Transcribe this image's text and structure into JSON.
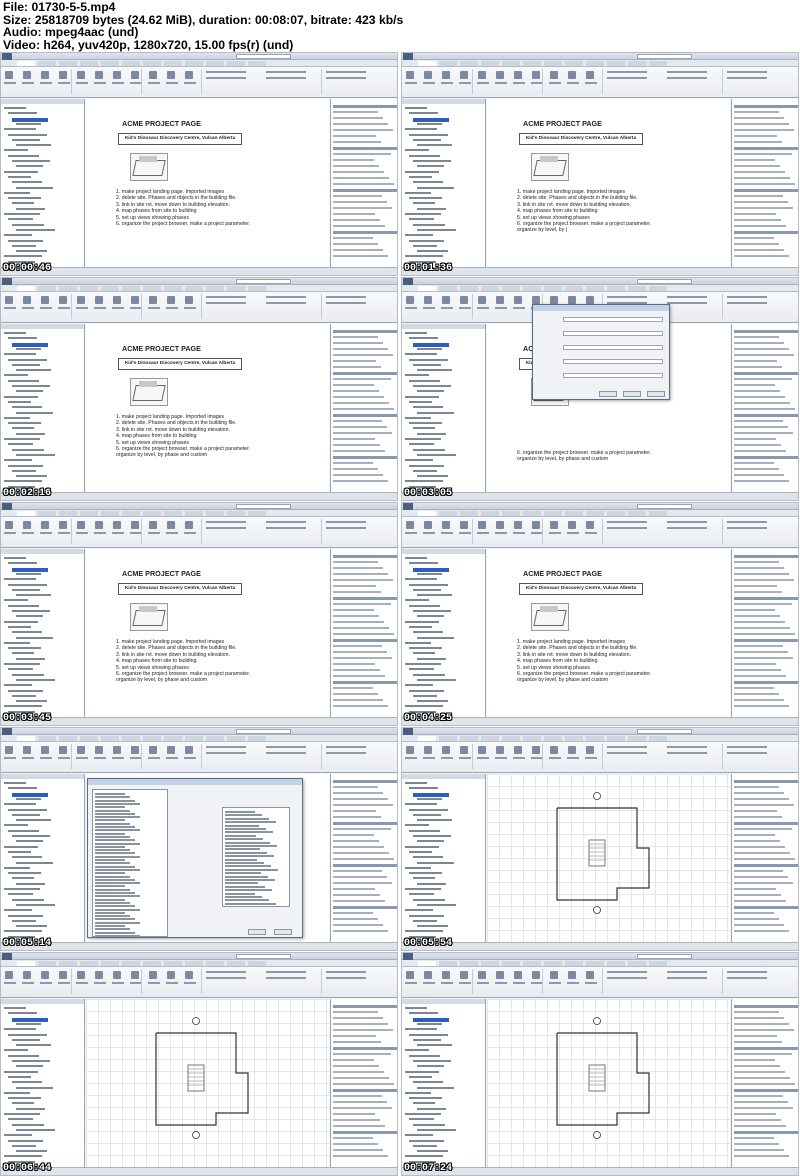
{
  "header": {
    "file": "File: 01730-5-5.mp4",
    "size": "Size: 25818709 bytes (24.62 MiB), duration: 00:08:07, bitrate: 423 kb/s",
    "audio": "Audio: mpeg4aac (und)",
    "video": "Video: h264, yuv420p, 1280x720, 15.00 fps(r) (und)"
  },
  "thumbnails": [
    {
      "timestamp": "00:00:46",
      "view": "page",
      "page_title": "ACME PROJECT PAGE",
      "project_name": "Kid's Dinosaur Discovery Centre, Vulcan Alberta",
      "notes": [
        "1. make project landing page. Imported images",
        "2. delete site. Phases and objects in the building file.",
        "3. link in site rvt. move down to building elevation.",
        "4. map phases from site to building",
        "5. set up views showing phases",
        "6. organize the project browser. make a project parameter."
      ]
    },
    {
      "timestamp": "00:01:36",
      "view": "page",
      "page_title": "ACME PROJECT PAGE",
      "project_name": "Kid's Dinosaur Discovery Centre, Vulcan Alberta",
      "notes": [
        "1. make project landing page. Imported images",
        "2. delete site. Phases and objects in the building file.",
        "3. link in site rvt. move down to building elevation.",
        "4. map phases from site to building",
        "5. set up views showing phases",
        "6. organize the project browser. make a project parameter.",
        "organize by level, by |"
      ]
    },
    {
      "timestamp": "00:02:16",
      "view": "page",
      "page_title": "ACME PROJECT PAGE",
      "project_name": "Kid's Dinosaur Discovery Centre, Vulcan Alberta",
      "notes": [
        "1. make project landing page. Imported images",
        "2. delete site. Phases and objects in the building file.",
        "3. link in site rvt. move down to building elevation.",
        "4. map phases from site to building",
        "5. set up views showing phases",
        "6. organize the project browser. make a project parameter.",
        "organize by level, by phase and custom"
      ]
    },
    {
      "timestamp": "00:03:05",
      "view": "page-dialog",
      "page_title": "ACME PROJECT PAGE",
      "project_name": "Kid's Dinosaur Discovery Centre, Vulcan Alberta",
      "notes": [
        "6. organize the project browser. make a project parameter.",
        "organize by level, by phase and custom"
      ]
    },
    {
      "timestamp": "00:03:45",
      "view": "page",
      "page_title": "ACME PROJECT PAGE",
      "project_name": "Kid's Dinosaur Discovery Centre, Vulcan Alberta",
      "notes": [
        "1. make project landing page. Imported images",
        "2. delete site. Phases and objects in the building file.",
        "3. link in site rvt. move down to building elevation.",
        "4. map phases from site to building",
        "5. set up views showing phases",
        "6. organize the project browser. make a project parameter.",
        "organize by level, by phase and custom"
      ]
    },
    {
      "timestamp": "00:04:25",
      "view": "page",
      "page_title": "ACME PROJECT PAGE",
      "project_name": "Kid's Dinosaur Discovery Centre, Vulcan Alberta",
      "notes": [
        "1. make project landing page. Imported images",
        "2. delete site. Phases and objects in the building file.",
        "3. link in site rvt. move down to building elevation.",
        "4. map phases from site to building",
        "5. set up views showing phases",
        "6. organize the project browser. make a project parameter.",
        "organize by level, by phase and custom"
      ]
    },
    {
      "timestamp": "00:05:14",
      "view": "categories-dialog"
    },
    {
      "timestamp": "00:05:54",
      "view": "plan"
    },
    {
      "timestamp": "00:06:44",
      "view": "plan"
    },
    {
      "timestamp": "00:07:24",
      "view": "plan"
    }
  ]
}
